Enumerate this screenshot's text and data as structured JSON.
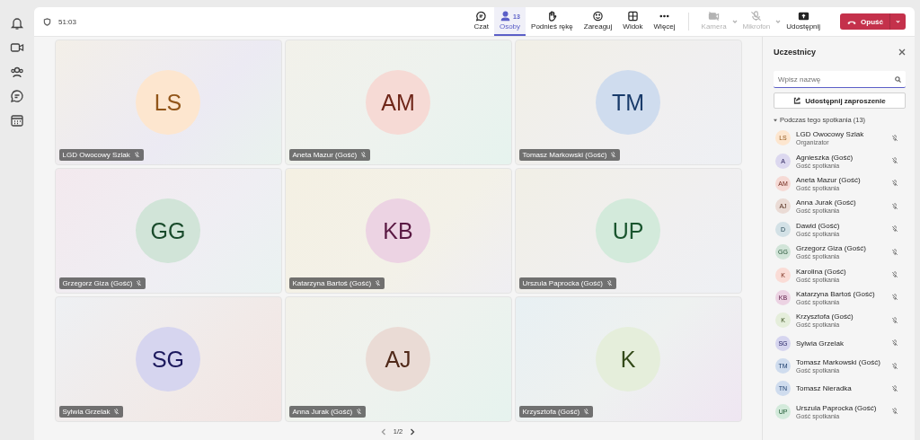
{
  "meeting": {
    "timer": "51:03"
  },
  "toolbar": {
    "buttons": [
      {
        "kind": "chat",
        "label": "Czat",
        "selected": false,
        "disabled": false
      },
      {
        "kind": "people",
        "label": "Osoby",
        "selected": true,
        "disabled": false,
        "badge": "13"
      },
      {
        "kind": "hand",
        "label": "Podnieś rękę",
        "selected": false,
        "disabled": false
      },
      {
        "kind": "react",
        "label": "Zareaguj",
        "selected": false,
        "disabled": false
      },
      {
        "kind": "view",
        "label": "Widok",
        "selected": false,
        "disabled": false
      },
      {
        "kind": "more",
        "label": "Więcej",
        "selected": false,
        "disabled": false
      },
      {
        "kind": "camera",
        "label": "Kamera",
        "selected": false,
        "disabled": true
      },
      {
        "kind": "mic",
        "label": "Mikrofon",
        "selected": false,
        "disabled": true
      },
      {
        "kind": "share",
        "label": "Udostępnij",
        "selected": false,
        "disabled": false
      }
    ],
    "leave": {
      "label": "Opuść"
    }
  },
  "tiles": [
    {
      "initials": "LS",
      "name": "LGD Owocowy Szlak",
      "color": "#fde6cf",
      "muted": true
    },
    {
      "initials": "AM",
      "name": "Aneta Mazur (Gość)",
      "color": "#f6dad5",
      "muted": true
    },
    {
      "initials": "TM",
      "name": "Tomasz Markowski (Gość)",
      "color": "#cfdcee",
      "muted": true
    },
    {
      "initials": "GG",
      "name": "Grzegorz Giza (Gość)",
      "color": "#d1e4d8",
      "muted": true
    },
    {
      "initials": "KB",
      "name": "Katarzyna Bartoś (Gość)",
      "color": "#ecd3e3",
      "muted": true
    },
    {
      "initials": "UP",
      "name": "Urszula Paprocka (Gość)",
      "color": "#d3eadb",
      "muted": true
    },
    {
      "initials": "SG",
      "name": "Sylwia Grzelak",
      "color": "#d6d5ef",
      "muted": true
    },
    {
      "initials": "AJ",
      "name": "Anna Jurak (Gość)",
      "color": "#eadbd5",
      "muted": true
    },
    {
      "initials": "K",
      "name": "Krzysztofa (Gość)",
      "color": "#e5eedb",
      "muted": true
    }
  ],
  "pager": {
    "label": "1/2"
  },
  "panel": {
    "title": "Uczestnicy",
    "search": {
      "placeholder": "Wpisz nazwę"
    },
    "invite_button": "Udostępnij zaproszenie",
    "section": {
      "label": "Podczas tego spotkania (13)",
      "expanded": true,
      "participants": [
        {
          "initials": "LS",
          "name": "LGD Owocowy Szlak",
          "role": "Organizator",
          "color": "#fde6cf",
          "muted": true
        },
        {
          "initials": "A",
          "name": "Agnieszka (Gość)",
          "role": "Gość spotkania",
          "color": "#dcd8ef",
          "muted": true
        },
        {
          "initials": "AM",
          "name": "Aneta Mazur (Gość)",
          "role": "Gość spotkania",
          "color": "#f6dad5",
          "muted": true
        },
        {
          "initials": "AJ",
          "name": "Anna Jurak (Gość)",
          "role": "Gość spotkania",
          "color": "#eadbd5",
          "muted": true
        },
        {
          "initials": "D",
          "name": "Dawid (Gość)",
          "role": "Gość spotkania",
          "color": "#d3e1e6",
          "muted": true
        },
        {
          "initials": "GG",
          "name": "Grzegorz Giza (Gość)",
          "role": "Gość spotkania",
          "color": "#d1e4d8",
          "muted": true
        },
        {
          "initials": "K",
          "name": "Karolina (Gość)",
          "role": "Gość spotkania",
          "color": "#fadcd6",
          "muted": true
        },
        {
          "initials": "KB",
          "name": "Katarzyna Bartoś (Gość)",
          "role": "Gość spotkania",
          "color": "#ecd3e3",
          "muted": true
        },
        {
          "initials": "K",
          "name": "Krzysztofa (Gość)",
          "role": "Gość spotkania",
          "color": "#e5eedb",
          "muted": true
        },
        {
          "initials": "SG",
          "name": "Sylwia Grzelak",
          "color": "#d6d5ef",
          "muted": true
        },
        {
          "initials": "TM",
          "name": "Tomasz Markowski (Gość)",
          "role": "Gość spotkania",
          "color": "#cfdcee",
          "muted": true
        },
        {
          "initials": "TN",
          "name": "Tomasz Nieradka",
          "color": "#cfdcee",
          "muted": true
        },
        {
          "initials": "UP",
          "name": "Urszula Paprocka (Gość)",
          "role": "Gość spotkania",
          "color": "#d3eadb",
          "muted": true
        }
      ]
    }
  }
}
